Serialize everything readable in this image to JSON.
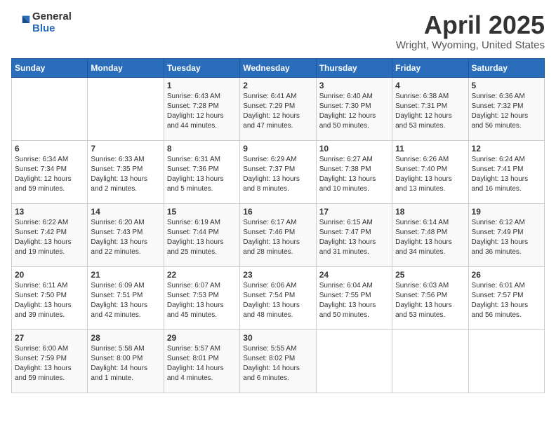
{
  "header": {
    "logo_general": "General",
    "logo_blue": "Blue",
    "title": "April 2025",
    "subtitle": "Wright, Wyoming, United States"
  },
  "days_of_week": [
    "Sunday",
    "Monday",
    "Tuesday",
    "Wednesday",
    "Thursday",
    "Friday",
    "Saturday"
  ],
  "weeks": [
    [
      {
        "day": "",
        "info": ""
      },
      {
        "day": "",
        "info": ""
      },
      {
        "day": "1",
        "info": "Sunrise: 6:43 AM\nSunset: 7:28 PM\nDaylight: 12 hours\nand 44 minutes."
      },
      {
        "day": "2",
        "info": "Sunrise: 6:41 AM\nSunset: 7:29 PM\nDaylight: 12 hours\nand 47 minutes."
      },
      {
        "day": "3",
        "info": "Sunrise: 6:40 AM\nSunset: 7:30 PM\nDaylight: 12 hours\nand 50 minutes."
      },
      {
        "day": "4",
        "info": "Sunrise: 6:38 AM\nSunset: 7:31 PM\nDaylight: 12 hours\nand 53 minutes."
      },
      {
        "day": "5",
        "info": "Sunrise: 6:36 AM\nSunset: 7:32 PM\nDaylight: 12 hours\nand 56 minutes."
      }
    ],
    [
      {
        "day": "6",
        "info": "Sunrise: 6:34 AM\nSunset: 7:34 PM\nDaylight: 12 hours\nand 59 minutes."
      },
      {
        "day": "7",
        "info": "Sunrise: 6:33 AM\nSunset: 7:35 PM\nDaylight: 13 hours\nand 2 minutes."
      },
      {
        "day": "8",
        "info": "Sunrise: 6:31 AM\nSunset: 7:36 PM\nDaylight: 13 hours\nand 5 minutes."
      },
      {
        "day": "9",
        "info": "Sunrise: 6:29 AM\nSunset: 7:37 PM\nDaylight: 13 hours\nand 8 minutes."
      },
      {
        "day": "10",
        "info": "Sunrise: 6:27 AM\nSunset: 7:38 PM\nDaylight: 13 hours\nand 10 minutes."
      },
      {
        "day": "11",
        "info": "Sunrise: 6:26 AM\nSunset: 7:40 PM\nDaylight: 13 hours\nand 13 minutes."
      },
      {
        "day": "12",
        "info": "Sunrise: 6:24 AM\nSunset: 7:41 PM\nDaylight: 13 hours\nand 16 minutes."
      }
    ],
    [
      {
        "day": "13",
        "info": "Sunrise: 6:22 AM\nSunset: 7:42 PM\nDaylight: 13 hours\nand 19 minutes."
      },
      {
        "day": "14",
        "info": "Sunrise: 6:20 AM\nSunset: 7:43 PM\nDaylight: 13 hours\nand 22 minutes."
      },
      {
        "day": "15",
        "info": "Sunrise: 6:19 AM\nSunset: 7:44 PM\nDaylight: 13 hours\nand 25 minutes."
      },
      {
        "day": "16",
        "info": "Sunrise: 6:17 AM\nSunset: 7:46 PM\nDaylight: 13 hours\nand 28 minutes."
      },
      {
        "day": "17",
        "info": "Sunrise: 6:15 AM\nSunset: 7:47 PM\nDaylight: 13 hours\nand 31 minutes."
      },
      {
        "day": "18",
        "info": "Sunrise: 6:14 AM\nSunset: 7:48 PM\nDaylight: 13 hours\nand 34 minutes."
      },
      {
        "day": "19",
        "info": "Sunrise: 6:12 AM\nSunset: 7:49 PM\nDaylight: 13 hours\nand 36 minutes."
      }
    ],
    [
      {
        "day": "20",
        "info": "Sunrise: 6:11 AM\nSunset: 7:50 PM\nDaylight: 13 hours\nand 39 minutes."
      },
      {
        "day": "21",
        "info": "Sunrise: 6:09 AM\nSunset: 7:51 PM\nDaylight: 13 hours\nand 42 minutes."
      },
      {
        "day": "22",
        "info": "Sunrise: 6:07 AM\nSunset: 7:53 PM\nDaylight: 13 hours\nand 45 minutes."
      },
      {
        "day": "23",
        "info": "Sunrise: 6:06 AM\nSunset: 7:54 PM\nDaylight: 13 hours\nand 48 minutes."
      },
      {
        "day": "24",
        "info": "Sunrise: 6:04 AM\nSunset: 7:55 PM\nDaylight: 13 hours\nand 50 minutes."
      },
      {
        "day": "25",
        "info": "Sunrise: 6:03 AM\nSunset: 7:56 PM\nDaylight: 13 hours\nand 53 minutes."
      },
      {
        "day": "26",
        "info": "Sunrise: 6:01 AM\nSunset: 7:57 PM\nDaylight: 13 hours\nand 56 minutes."
      }
    ],
    [
      {
        "day": "27",
        "info": "Sunrise: 6:00 AM\nSunset: 7:59 PM\nDaylight: 13 hours\nand 59 minutes."
      },
      {
        "day": "28",
        "info": "Sunrise: 5:58 AM\nSunset: 8:00 PM\nDaylight: 14 hours\nand 1 minute."
      },
      {
        "day": "29",
        "info": "Sunrise: 5:57 AM\nSunset: 8:01 PM\nDaylight: 14 hours\nand 4 minutes."
      },
      {
        "day": "30",
        "info": "Sunrise: 5:55 AM\nSunset: 8:02 PM\nDaylight: 14 hours\nand 6 minutes."
      },
      {
        "day": "",
        "info": ""
      },
      {
        "day": "",
        "info": ""
      },
      {
        "day": "",
        "info": ""
      }
    ]
  ]
}
